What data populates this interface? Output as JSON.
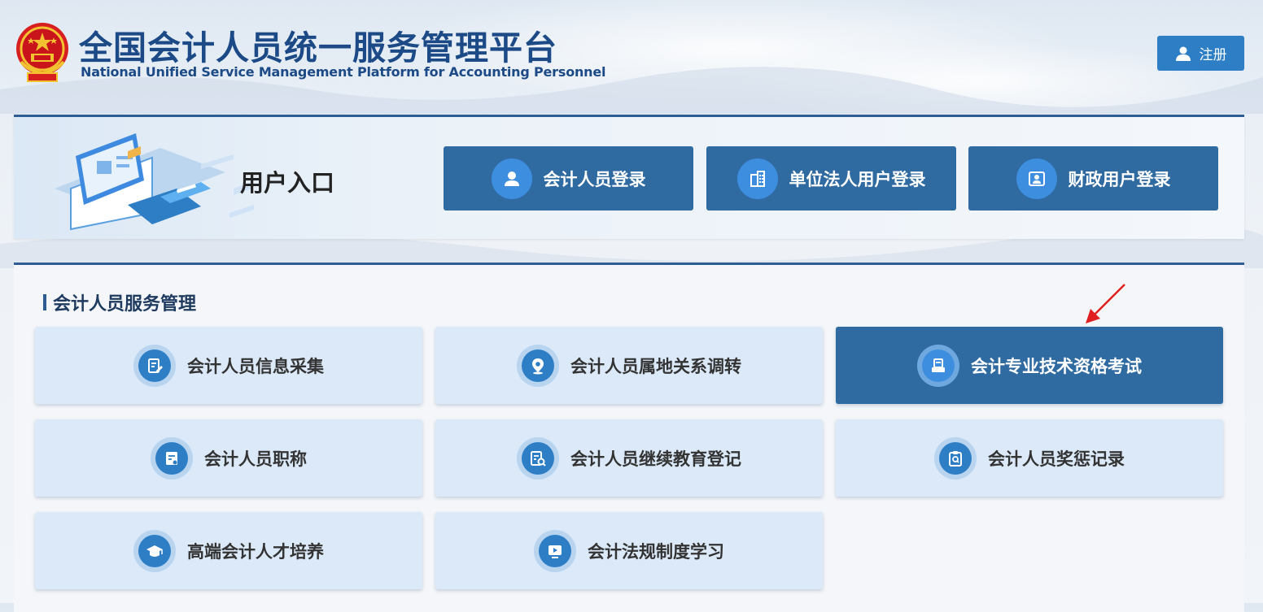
{
  "header": {
    "title_cn": "全国会计人员统一服务管理平台",
    "title_en": "National Unified Service Management Platform for Accounting Personnel",
    "register_label": "注册"
  },
  "entry": {
    "title": "用户入口",
    "buttons": [
      {
        "label": "会计人员登录",
        "icon": "user-icon"
      },
      {
        "label": "单位法人用户登录",
        "icon": "building-icon"
      },
      {
        "label": "财政用户登录",
        "icon": "id-card-icon"
      }
    ]
  },
  "services": {
    "section_title": "会计人员服务管理",
    "items": [
      {
        "label": "会计人员信息采集",
        "icon": "edit-document-icon",
        "active": false
      },
      {
        "label": "会计人员属地关系调转",
        "icon": "location-pin-icon",
        "active": false
      },
      {
        "label": "会计专业技术资格考试",
        "icon": "exam-icon",
        "active": true
      },
      {
        "label": "会计人员职称",
        "icon": "certificate-icon",
        "active": false
      },
      {
        "label": "会计人员继续教育登记",
        "icon": "document-search-icon",
        "active": false
      },
      {
        "label": "会计人员奖惩记录",
        "icon": "clipboard-search-icon",
        "active": false
      },
      {
        "label": "高端会计人才培养",
        "icon": "graduation-cap-icon",
        "active": false
      },
      {
        "label": "会计法规制度学习",
        "icon": "video-play-icon",
        "active": false
      }
    ]
  },
  "colors": {
    "brand_dark": "#2f6aa1",
    "brand_accent": "#2e7ec6",
    "title_blue": "#1c4a86",
    "card_bg": "#dbe9f8",
    "annotation_red": "#e02020"
  }
}
